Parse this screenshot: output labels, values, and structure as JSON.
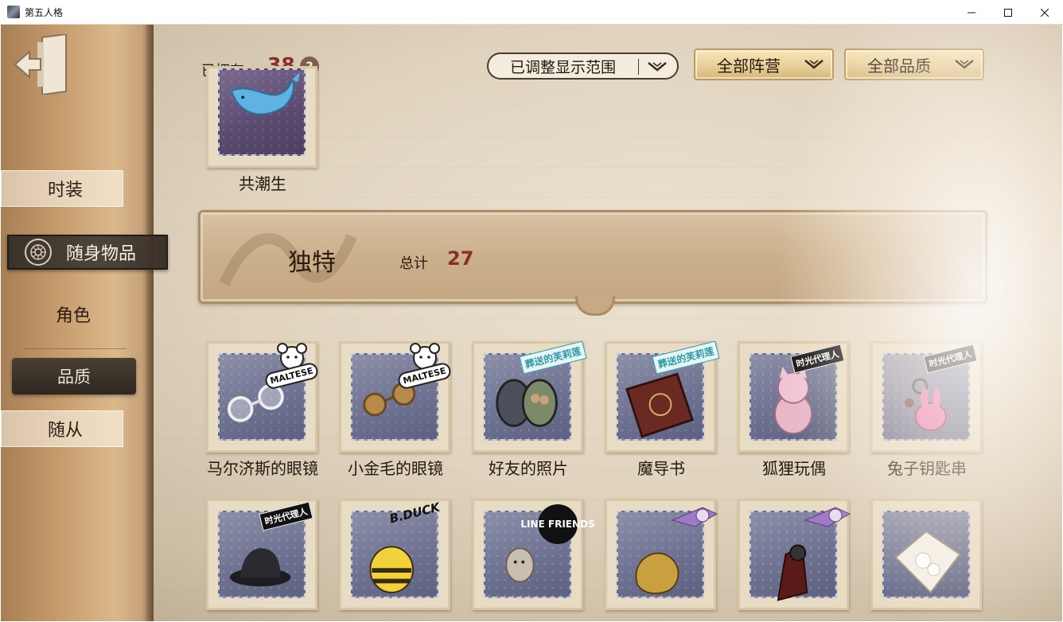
{
  "window": {
    "title": "第五人格"
  },
  "sidebar": {
    "items": [
      {
        "label": "时装"
      },
      {
        "label": "随身物品"
      },
      {
        "label": "角色"
      },
      {
        "label": "品质"
      },
      {
        "label": "随从"
      }
    ]
  },
  "header": {
    "owned_label": "已拥有",
    "owned_count": "38",
    "help": "?",
    "range_filter": "已调整显示范围",
    "camp_filter": "全部阵营",
    "quality_filter": "全部品质"
  },
  "prev_section": {
    "item": {
      "name": "共潮生"
    }
  },
  "section": {
    "title": "独特",
    "total_label": "总计",
    "total": "27"
  },
  "tags": {
    "maltese": "MALTESE",
    "times": "时光代理人",
    "mocking": "葬送的芙莉莲",
    "bduck": "B.DUCK",
    "line": "LINE FRIENDS"
  },
  "items_row1": [
    {
      "name": "马尔济斯的眼镜"
    },
    {
      "name": "小金毛的眼镜"
    },
    {
      "name": "好友的照片"
    },
    {
      "name": "魔导书"
    },
    {
      "name": "狐狸玩偶"
    },
    {
      "name": "兔子钥匙串"
    }
  ],
  "colors": {
    "accent_red": "#8a2e2a",
    "dark_tab": "#3a332c",
    "gold_dropdown": "#e8d09a"
  }
}
